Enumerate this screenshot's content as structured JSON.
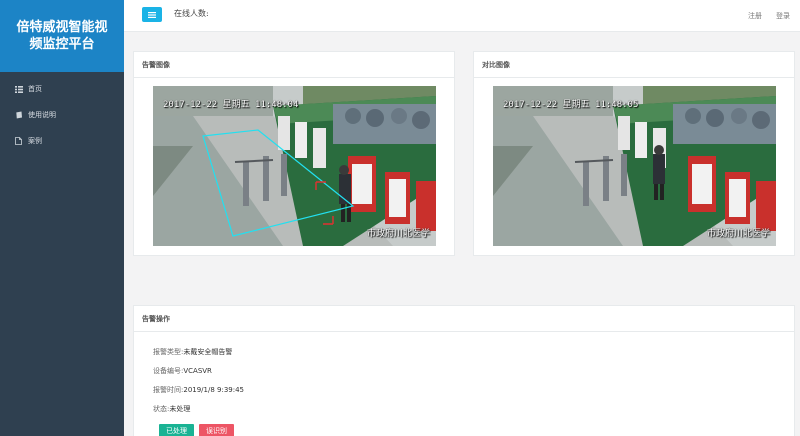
{
  "app": {
    "title_line1": "倍特威视智能视",
    "title_line2": "频监控平台"
  },
  "sidebar": {
    "items": [
      {
        "label": "首页",
        "icon": "grid-icon"
      },
      {
        "label": "使用说明",
        "icon": "book-icon"
      },
      {
        "label": "案例",
        "icon": "file-icon"
      }
    ]
  },
  "header": {
    "online_label": "在线人数:",
    "register": "注册",
    "login": "登录"
  },
  "alarm_panel": {
    "title": "告警图像",
    "timestamp": "2017-12-22 星期五 11:48:04",
    "caption": "市政府川北医学"
  },
  "compare_panel": {
    "title": "对比图像",
    "timestamp": "2017-12-22 星期五 11:48:05",
    "caption": "市政府川北医学"
  },
  "ops_panel": {
    "title": "告警操作",
    "rows": [
      {
        "label": "报警类型:",
        "value": "未戴安全帽告警"
      },
      {
        "label": "设备编号:",
        "value": "VCASVR"
      },
      {
        "label": "报警时间:",
        "value": "2019/1/8 9:39:45"
      },
      {
        "label": "状态:",
        "value": "未处理"
      }
    ],
    "btn_processed": "已处理",
    "btn_misreport": "误识别"
  },
  "colors": {
    "sidebar_bg": "#2f4050",
    "brand_bg": "#1c84c6",
    "menu_btn": "#1ab3e6",
    "btn_processed": "#1ab394",
    "btn_misreport": "#ed5565",
    "detect_zone": "#22e0f0",
    "detect_box": "#e23030"
  }
}
